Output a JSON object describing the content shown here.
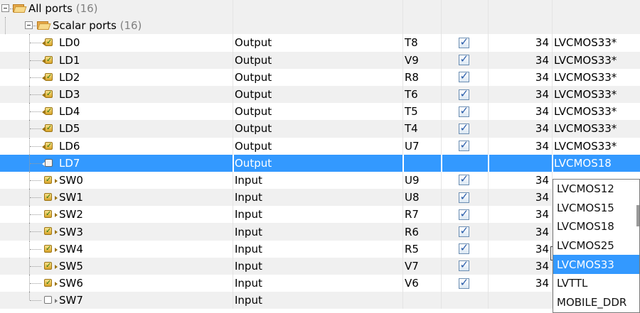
{
  "tree": {
    "root": {
      "label": "All ports",
      "count": "(16)"
    },
    "group": {
      "label": "Scalar ports",
      "count": "(16)"
    },
    "ports": [
      {
        "name": "LD0",
        "direction": "Output",
        "site": "T8",
        "fixed": true,
        "bank": "34",
        "standard": "LVCMOS33*",
        "icon": "output-port-icon"
      },
      {
        "name": "LD1",
        "direction": "Output",
        "site": "V9",
        "fixed": true,
        "bank": "34",
        "standard": "LVCMOS33*",
        "icon": "output-port-icon"
      },
      {
        "name": "LD2",
        "direction": "Output",
        "site": "R8",
        "fixed": true,
        "bank": "34",
        "standard": "LVCMOS33*",
        "icon": "output-port-icon"
      },
      {
        "name": "LD3",
        "direction": "Output",
        "site": "T6",
        "fixed": true,
        "bank": "34",
        "standard": "LVCMOS33*",
        "icon": "output-port-icon"
      },
      {
        "name": "LD4",
        "direction": "Output",
        "site": "T5",
        "fixed": true,
        "bank": "34",
        "standard": "LVCMOS33*",
        "icon": "output-port-icon"
      },
      {
        "name": "LD5",
        "direction": "Output",
        "site": "T4",
        "fixed": true,
        "bank": "34",
        "standard": "LVCMOS33*",
        "icon": "output-port-icon"
      },
      {
        "name": "LD6",
        "direction": "Output",
        "site": "U7",
        "fixed": true,
        "bank": "34",
        "standard": "LVCMOS33*",
        "icon": "output-port-icon"
      },
      {
        "name": "LD7",
        "direction": "Output",
        "site": "",
        "fixed": false,
        "bank": "",
        "standard": "LVCMOS18",
        "icon": "unassigned-output-port-icon"
      },
      {
        "name": "SW0",
        "direction": "Input",
        "site": "U9",
        "fixed": true,
        "bank": "34",
        "standard": "",
        "icon": "input-port-icon"
      },
      {
        "name": "SW1",
        "direction": "Input",
        "site": "U8",
        "fixed": true,
        "bank": "34",
        "standard": "",
        "icon": "input-port-icon"
      },
      {
        "name": "SW2",
        "direction": "Input",
        "site": "R7",
        "fixed": true,
        "bank": "34",
        "standard": "",
        "icon": "input-port-icon"
      },
      {
        "name": "SW3",
        "direction": "Input",
        "site": "R6",
        "fixed": true,
        "bank": "34",
        "standard": "",
        "icon": "input-port-icon"
      },
      {
        "name": "SW4",
        "direction": "Input",
        "site": "R5",
        "fixed": true,
        "bank": "34",
        "standard": "",
        "icon": "input-port-icon"
      },
      {
        "name": "SW5",
        "direction": "Input",
        "site": "V7",
        "fixed": true,
        "bank": "34",
        "standard": "",
        "icon": "input-port-icon"
      },
      {
        "name": "SW6",
        "direction": "Input",
        "site": "V6",
        "fixed": true,
        "bank": "34",
        "standard": "",
        "icon": "input-port-icon"
      },
      {
        "name": "SW7",
        "direction": "Input",
        "site": "",
        "fixed": false,
        "bank": "",
        "standard": "",
        "icon": "unassigned-input-port-icon"
      }
    ]
  },
  "selected_port": "LD7",
  "iostandard_dropdown": {
    "options": [
      "LVCMOS12",
      "LVCMOS15",
      "LVCMOS18",
      "LVCMOS25",
      "LVCMOS33",
      "LVTTL",
      "MOBILE_DDR"
    ],
    "highlighted": "LVCMOS33"
  },
  "colors": {
    "selection": "#3399ff",
    "alt_row": "#f0f0f0"
  }
}
